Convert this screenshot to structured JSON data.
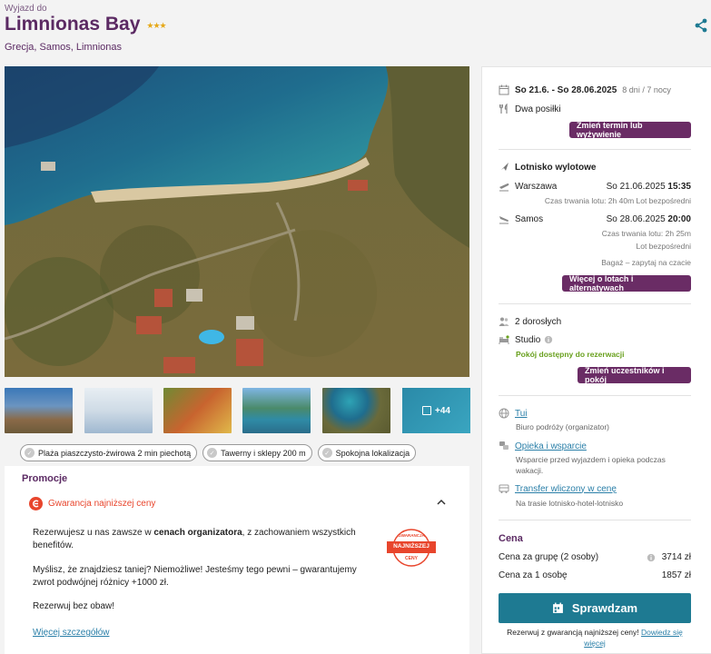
{
  "header": {
    "eyebrow": "Wyjazd do",
    "title": "Limnionas Bay",
    "stars": "★★★",
    "location": "Grecja, Samos, Limnionas"
  },
  "gallery": {
    "more_count": "+44"
  },
  "features": [
    "Plaża piaszczysto-żwirowa 2 min piechotą",
    "Tawerny i sklepy 200 m",
    "Spokojna lokalizacja"
  ],
  "promo": {
    "title": "Promocje",
    "guarantee_label": "Gwarancja najniższej ceny",
    "p1_a": "Rezerwujesz u nas zawsze w ",
    "p1_b": "cenach organizatora",
    "p1_c": ", z zachowaniem wszystkich benefitów.",
    "p2": "Myślisz, że znajdziesz taniej? Niemożliwe! Jesteśmy tego pewni – gwarantujemy zwrot podwójnej różnicy +1000 zł.",
    "p3": "Rezerwuj bez obaw!",
    "more_link": "Więcej szczegółów",
    "badge_top": "GWARANCJA",
    "badge_mid": "NAJNIŻSZEJ",
    "badge_bot": "CENY"
  },
  "trip": {
    "dates": "So 21.6. - So 28.06.2025",
    "duration": "8 dni / 7 nocy",
    "board": "Dwa posiłki",
    "change_term_btn": "Zmień termin lub wyżywienie"
  },
  "flights": {
    "airport_label": "Lotnisko wylotowe",
    "out_city": "Warszawa",
    "out_date": "So 21.06.2025",
    "out_time": "15:35",
    "out_info": "Czas trwania lotu: 2h 40m Lot bezpośredni",
    "ret_city": "Samos",
    "ret_date": "So 28.06.2025",
    "ret_time": "20:00",
    "ret_info1": "Czas trwania lotu: 2h 25m",
    "ret_info2": "Lot bezpośredni",
    "baggage": "Bagaż – zapytaj na czacie",
    "more_flights_btn": "Więcej o lotach i alternatywach"
  },
  "room": {
    "guests": "2 dorosłych",
    "room_type": "Studio",
    "availability": "Pokój dostępny do rezerwacji",
    "change_btn": "Zmień uczestników i pokój"
  },
  "services": {
    "operator_link": "Tui",
    "operator_sub": "Biuro podróży (organizator)",
    "care_link": "Opieka i wsparcie",
    "care_sub": "Wsparcie przed wyjazdem i opieka podczas wakacji.",
    "transfer_link": "Transfer wliczony w cenę",
    "transfer_sub": "Na trasie lotnisko-hotel-lotnisko"
  },
  "price": {
    "heading": "Cena",
    "group_label": "Cena za grupę (2 osoby)",
    "group_value": "3714 zł",
    "person_label": "Cena za 1 osobę",
    "person_value": "1857 zł",
    "cta_label": "Sprawdzam",
    "note": "Rezerwuj z gwarancją najniższej ceny!",
    "note_link": "Dowiedz się więcej"
  },
  "colors": {
    "brand": "#5b2a63",
    "button": "#6a2c65",
    "cta": "#1e7a92",
    "link": "#2a7fa8",
    "accent": "#e8452c"
  }
}
